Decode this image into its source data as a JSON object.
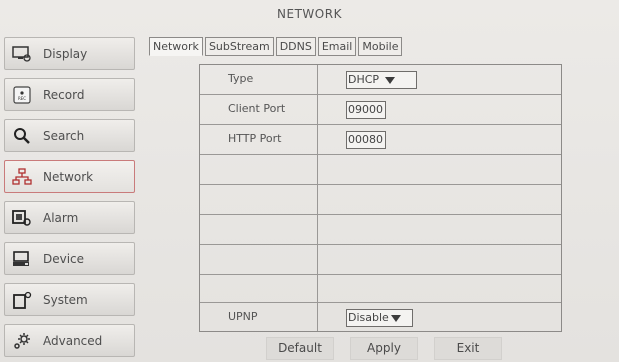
{
  "window": {
    "title": "NETWORK"
  },
  "sidebar": {
    "items": [
      {
        "label": "Display",
        "icon": "display-icon"
      },
      {
        "label": "Record",
        "icon": "record-icon"
      },
      {
        "label": "Search",
        "icon": "search-icon"
      },
      {
        "label": "Network",
        "icon": "network-icon",
        "active": true
      },
      {
        "label": "Alarm",
        "icon": "alarm-icon"
      },
      {
        "label": "Device",
        "icon": "device-icon"
      },
      {
        "label": "System",
        "icon": "system-icon"
      },
      {
        "label": "Advanced",
        "icon": "advanced-icon"
      }
    ]
  },
  "tabs": [
    {
      "label": "Network",
      "active": true
    },
    {
      "label": "SubStream"
    },
    {
      "label": "DDNS"
    },
    {
      "label": "Email"
    },
    {
      "label": "Mobile"
    }
  ],
  "form": {
    "type": {
      "label": "Type",
      "value": "DHCP"
    },
    "client_port": {
      "label": "Client Port",
      "value": "09000"
    },
    "http_port": {
      "label": "HTTP Port",
      "value": "00080"
    },
    "upnp": {
      "label": "UPNP",
      "value": "Disable"
    }
  },
  "buttons": {
    "default": "Default",
    "apply": "Apply",
    "exit": "Exit"
  },
  "colors": {
    "active_border": "#c97b7b",
    "background": "#e9e7e4"
  }
}
